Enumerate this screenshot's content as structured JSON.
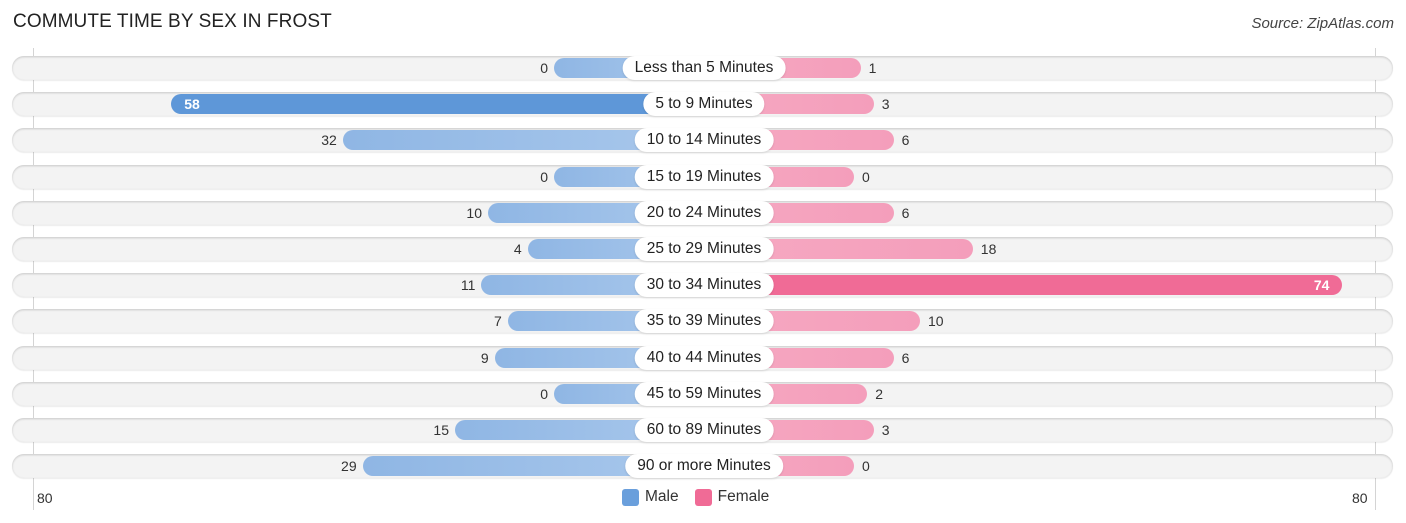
{
  "header": {
    "title": "COMMUTE TIME BY SEX IN FROST",
    "source": "Source: ZipAtlas.com"
  },
  "colors": {
    "male": "#6a9fdc",
    "male_highlight": "#5e97d8",
    "female": "#f4a0bd",
    "female_highlight": "#f06b96"
  },
  "chart_data": {
    "type": "bar",
    "orientation": "horizontal-diverging",
    "title": "COMMUTE TIME BY SEX IN FROST",
    "categories": [
      "Less than 5 Minutes",
      "5 to 9 Minutes",
      "10 to 14 Minutes",
      "15 to 19 Minutes",
      "20 to 24 Minutes",
      "25 to 29 Minutes",
      "30 to 34 Minutes",
      "35 to 39 Minutes",
      "40 to 44 Minutes",
      "45 to 59 Minutes",
      "60 to 89 Minutes",
      "90 or more Minutes"
    ],
    "series": [
      {
        "name": "Male",
        "values": [
          0,
          58,
          32,
          0,
          10,
          4,
          11,
          7,
          9,
          0,
          15,
          29
        ]
      },
      {
        "name": "Female",
        "values": [
          1,
          3,
          6,
          0,
          6,
          18,
          74,
          10,
          6,
          2,
          3,
          0
        ]
      }
    ],
    "axis": {
      "left_tick": "80",
      "right_tick": "80",
      "range": [
        0,
        80
      ]
    },
    "legend": {
      "entries": [
        "Male",
        "Female"
      ],
      "placement": "bottom-center"
    },
    "xlabel": "",
    "ylabel": ""
  }
}
